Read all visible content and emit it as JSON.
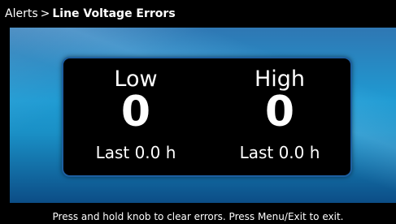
{
  "breadcrumb": {
    "parent": "Alerts",
    "separator": ">",
    "current": "Line Voltage Errors"
  },
  "errors": {
    "low": {
      "label": "Low",
      "count": "0",
      "last": "Last 0.0 h"
    },
    "high": {
      "label": "High",
      "count": "0",
      "last": "Last 0.0 h"
    }
  },
  "footer": {
    "instructions": "Press and hold knob to clear errors.  Press Menu/Exit to exit."
  },
  "colors": {
    "background": "#000000",
    "stage_blue": "#1f9bd3",
    "panel_border": "#1d5fa0",
    "text": "#ffffff"
  }
}
